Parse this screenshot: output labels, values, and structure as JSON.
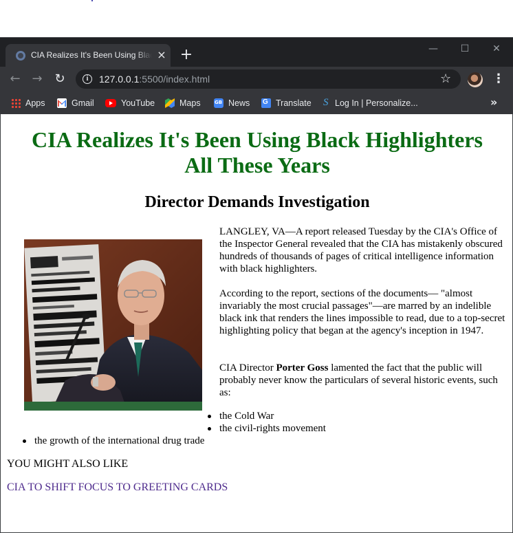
{
  "browser": {
    "tab_title": "CIA Realizes It's Been Using Black Highlighters All These Years",
    "tab_close": "×",
    "new_tab": "+",
    "window_controls": {
      "minimize": "—",
      "maximize": "☐",
      "close": "✕"
    },
    "url_host": "127.0.0.1",
    "url_path": ":5500/index.html",
    "bookmarks": [
      {
        "label": "Apps",
        "icon": "apps-icon"
      },
      {
        "label": "Gmail",
        "icon": "gmail-icon"
      },
      {
        "label": "YouTube",
        "icon": "youtube-icon"
      },
      {
        "label": "Maps",
        "icon": "maps-icon"
      },
      {
        "label": "News",
        "icon": "news-icon"
      },
      {
        "label": "Translate",
        "icon": "translate-icon"
      },
      {
        "label": "Log In | Personalize...",
        "icon": "login-icon"
      }
    ],
    "bookmarks_more": "»"
  },
  "article": {
    "headline": "CIA Realizes It's Been Using Black Highlighters All These Years",
    "subheadline": "Director Demands Investigation",
    "paragraph_1": "LANGLEY, VA—A report released Tuesday by the CIA's Office of the Inspector General revealed that the CIA has mistakenly obscured hundreds of thousands of pages of critical intelligence information with black highlighters.",
    "paragraph_2": "According to the report, sections of the documents— \"almost invariably the most crucial passages\"—are marred by an indelible black ink that renders the lines impossible to read, due to a top-secret highlighting policy that began at the agency's inception in 1947.",
    "paragraph_3_before": "CIA Director ",
    "paragraph_3_bold": "Porter Goss",
    "paragraph_3_after": " lamented the fact that the public will probably never know the particulars of several historic events, such as:",
    "events": [
      "the Cold War",
      "the civil-rights movement",
      "the growth of the international drug trade"
    ],
    "also_heading": "YOU MIGHT ALSO LIKE",
    "also_link": "CIA TO SHIFT FOCUS TO GREETING CARDS"
  },
  "colors": {
    "headline": "#0b6b14",
    "link_visited": "#4d2a8c",
    "chrome_dark": "#202124",
    "chrome_toolbar": "#35363a"
  }
}
